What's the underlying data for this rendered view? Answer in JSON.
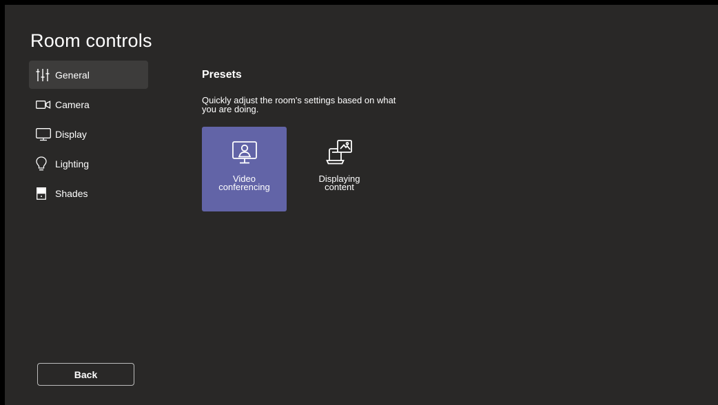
{
  "app": {
    "title": "Room controls"
  },
  "nav": {
    "items": [
      {
        "label": "General",
        "icon": "sliders-icon",
        "active": true
      },
      {
        "label": "Camera",
        "icon": "camera-icon",
        "active": false
      },
      {
        "label": "Display",
        "icon": "monitor-icon",
        "active": false
      },
      {
        "label": "Lighting",
        "icon": "lightbulb-icon",
        "active": false
      },
      {
        "label": "Shades",
        "icon": "shades-icon",
        "active": false
      }
    ]
  },
  "presets": {
    "title": "Presets",
    "description": "Quickly adjust the room's settings based on what you are doing.",
    "items": [
      {
        "label": "Video\nconferencing",
        "icon": "video-conferencing-icon",
        "selected": true
      },
      {
        "label": "Displaying\ncontent",
        "icon": "displaying-content-icon",
        "selected": false
      }
    ]
  },
  "footer": {
    "back_label": "Back"
  },
  "colors": {
    "background": "#292827",
    "nav_active": "#3d3c3b",
    "accent": "#6264a7",
    "text": "#ffffff"
  }
}
